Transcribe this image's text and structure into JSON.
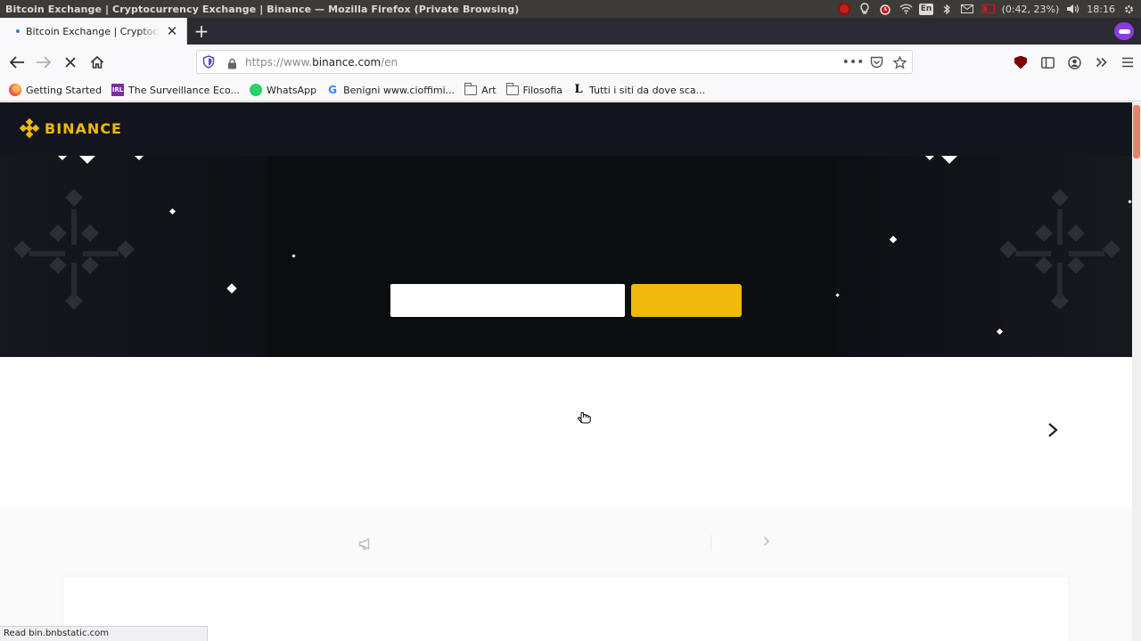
{
  "os": {
    "window_title": "Bitcoin Exchange | Cryptocurrency Exchange | Binance — Mozilla Firefox (Private Browsing)",
    "keyboard_layout": "En",
    "battery_text": "(0:42, 23%)",
    "clock": "18:16"
  },
  "browser": {
    "tab": {
      "title": "Bitcoin Exchange | Cryptocurrency Exchange | Binance"
    },
    "url": {
      "prefix": "https://www.",
      "domain": "binance.com",
      "path": "/en"
    },
    "bookmarks": [
      {
        "label": "Getting Started",
        "icon": "firefox-icon"
      },
      {
        "label": "The Surveillance Eco...",
        "icon": "irl-icon"
      },
      {
        "label": "WhatsApp",
        "icon": "whatsapp-icon"
      },
      {
        "label": "Benigni www.cioffimi...",
        "icon": "google-icon"
      },
      {
        "label": "Art",
        "icon": "folder-icon"
      },
      {
        "label": "Filosofia",
        "icon": "folder-icon"
      },
      {
        "label": "Tutti i siti da dove sca...",
        "icon": "letter-l-icon"
      }
    ],
    "status_text": "Read bin.bnbstatic.com"
  },
  "site": {
    "logo_text": "BINANCE",
    "brand_color": "#f0b90b"
  }
}
